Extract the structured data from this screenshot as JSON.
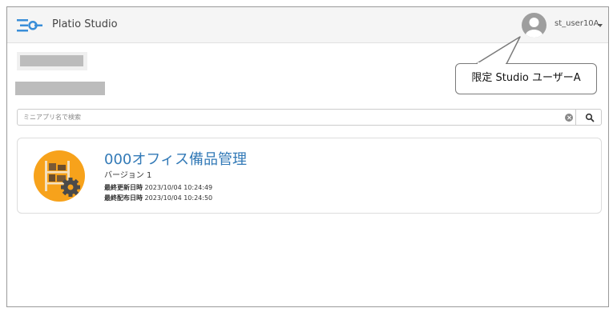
{
  "header": {
    "brand": "Platio Studio",
    "user_name": "st_user10A"
  },
  "callout": {
    "text": "限定 Studio ユーザーA"
  },
  "search": {
    "placeholder": "ミニアプリ名で検索",
    "value": ""
  },
  "apps": [
    {
      "name": "000オフィス備品管理",
      "version": "バージョン 1",
      "updated_label": "最終更新日時",
      "updated_at": "2023/10/04 10:24:49",
      "published_label": "最終配布日時",
      "published_at": "2023/10/04 10:24:50"
    }
  ],
  "colors": {
    "logo_blue": "#3a8ed8",
    "link_blue": "#337ab7",
    "app_icon_orange": "#f7a21b"
  },
  "icons": {
    "logo": "platio-logo-icon",
    "avatar": "user-avatar-icon",
    "clear": "clear-circle-icon",
    "search": "search-icon",
    "app": "shelf-gear-icon"
  }
}
